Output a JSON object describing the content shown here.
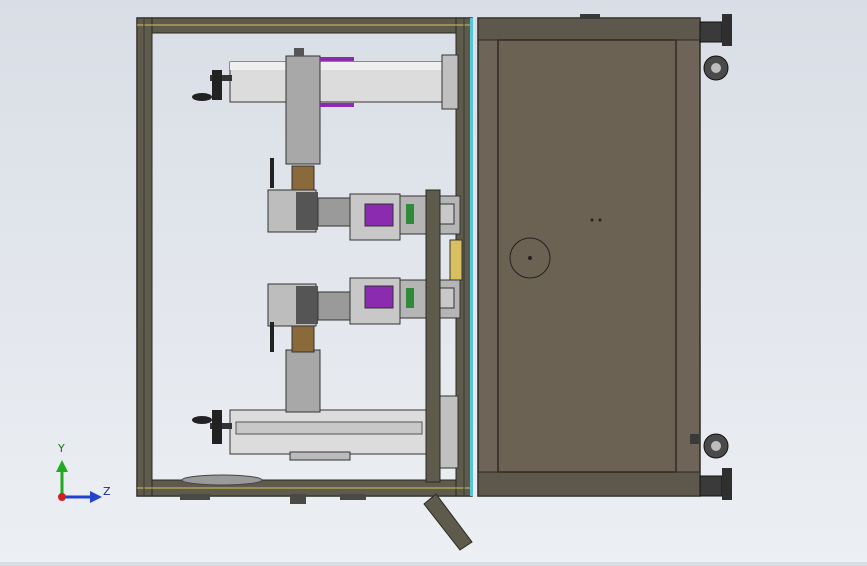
{
  "triad": {
    "y_label": "Y",
    "z_label": "Z",
    "colors": {
      "y": "#1faa1f",
      "z": "#2244cc",
      "origin": "#cc2222"
    }
  },
  "colors": {
    "frame": "#5e5a4c",
    "frame_edge": "#2a2a22",
    "cabinet": "#6e6558",
    "cabinet_panel": "#6c6254",
    "cylinder": "#dcdcdc",
    "carriage": "#a8a8a8",
    "brown_block": "#8a6a3a",
    "purple_part": "#8a2bb0",
    "green_part": "#2f8a3a",
    "cyan_edge": "#55c6d6",
    "caster": "#3a3a3a"
  }
}
